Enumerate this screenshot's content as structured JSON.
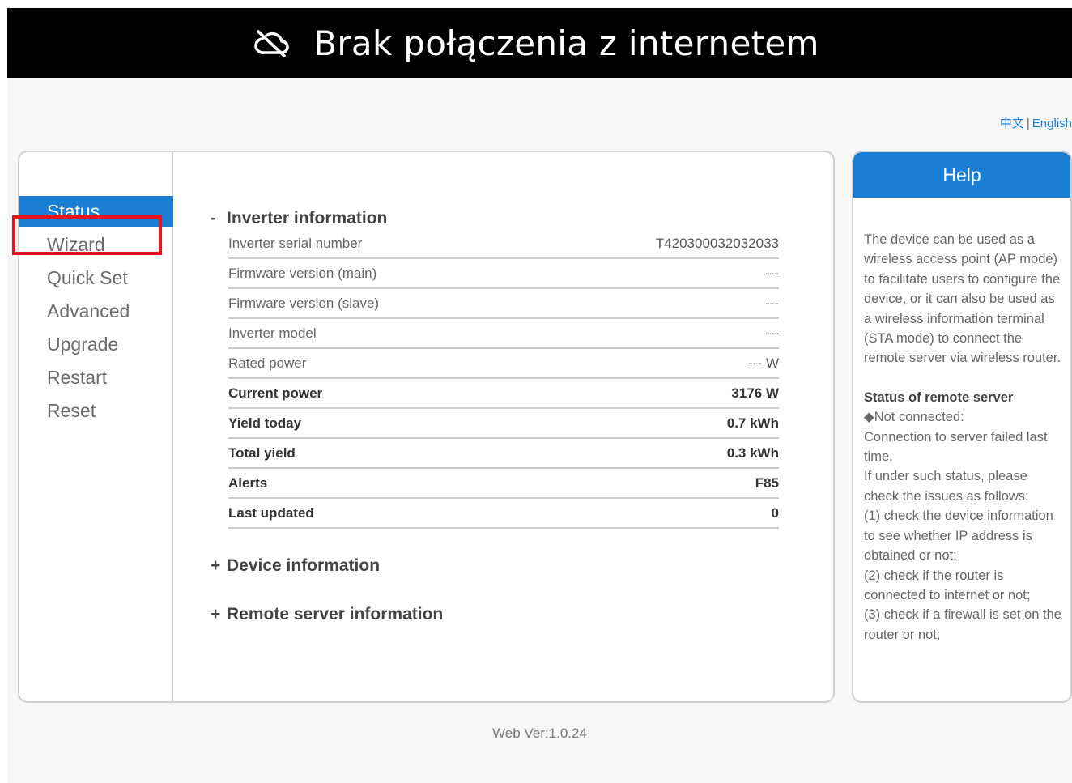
{
  "banner": {
    "text": "Brak połączenia z internetem",
    "icon": "cloud-off-icon"
  },
  "lang": {
    "chinese": "中文",
    "separator": "|",
    "english": "English"
  },
  "nav": {
    "items": [
      {
        "label": "Status"
      },
      {
        "label": "Wizard"
      },
      {
        "label": "Quick Set"
      },
      {
        "label": "Advanced"
      },
      {
        "label": "Upgrade"
      },
      {
        "label": "Restart"
      },
      {
        "label": "Reset"
      }
    ],
    "active": "Status",
    "highlighted": "Wizard"
  },
  "inverter": {
    "toggle": "-",
    "title": "Inverter information",
    "rows": [
      {
        "label": "Inverter serial number",
        "value": "T420300032032033"
      },
      {
        "label": "Firmware version (main)",
        "value": "---"
      },
      {
        "label": "Firmware version (slave)",
        "value": "---"
      },
      {
        "label": "Inverter model",
        "value": "---"
      },
      {
        "label": "Rated power",
        "value": "--- W"
      },
      {
        "label": "Current power",
        "value": "3176 W"
      },
      {
        "label": "Yield today",
        "value": "0.7 kWh"
      },
      {
        "label": "Total yield",
        "value": "0.3 kWh"
      },
      {
        "label": "Alerts",
        "value": "F85"
      },
      {
        "label": "Last updated",
        "value": "0"
      }
    ]
  },
  "device": {
    "toggle": "+",
    "title": "Device information"
  },
  "remote": {
    "toggle": "+",
    "title": "Remote server information"
  },
  "help": {
    "title": "Help",
    "intro": "The device can be used as a wireless access point (AP mode) to facilitate users to configure the device, or it can also be used as a wireless information terminal (STA mode) to connect the remote server via wireless router.",
    "status_heading": "Status of remote server",
    "lines": [
      "◆Not connected:",
      "Connection to server failed last time.",
      "If under such status, please check the issues as follows:",
      "(1) check the device information to see whether IP address is obtained or not;",
      "(2) check if the router is connected to internet or not;",
      "(3) check if a firewall is set on the router or not;"
    ]
  },
  "footer": {
    "version": "Web Ver:1.0.24"
  }
}
